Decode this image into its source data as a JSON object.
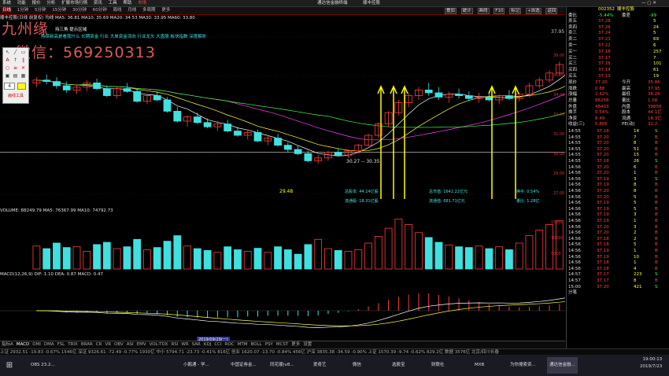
{
  "menu": {
    "items": [
      "系统",
      "功能",
      "报价",
      "分析",
      "扩展市场行情",
      "资讯",
      "工具",
      "帮助",
      "市场"
    ],
    "title": "通达信金融终端",
    "title2": "顺丰控股"
  },
  "tabs": {
    "items": [
      "日线",
      "1分钟",
      "5分钟",
      "15分钟",
      "30分钟",
      "60分钟",
      "周线",
      "月线",
      "多周期",
      "更多"
    ],
    "active": 0
  },
  "toolbar_right": {
    "btns": [
      "叠加",
      "统计",
      "画线",
      "F10",
      "标记",
      "+自选",
      "返回"
    ]
  },
  "watermark": {
    "line1": "九州缘",
    "line2": "微信：569250313"
  },
  "info_line": {
    "text": "顺丰控股(日线 前复权) 均线 MA5: 36.81  MA10: 35.69  MA20: 34.53  MA30: 33.95  MA60: 33.80"
  },
  "subheader": {
    "text": "持续新高是看我什么 长期资金 行业 大单资金流向 行业龙头 大盘股 板块指数 深度解析"
  },
  "annotation": {
    "text": "持三角 提示区域"
  },
  "price_labels": {
    "high": "37.95",
    "low": "29.48",
    "mid": "30.27 -- 30.35"
  },
  "axis_labels": [
    "39.00",
    "36.00",
    "34.00",
    "32.00",
    "31.00",
    "30.00",
    "29.00",
    "27.00",
    "27.52"
  ],
  "info_box": {
    "a": "总股本: 44.14亿股",
    "b": "总市值: 1642.22亿元",
    "c": "换手: 0.54%",
    "d": "流通股: 18.31亿股",
    "e": "流通值: 681.71亿元",
    "f": "量比: 1.28亿"
  },
  "vol_header": {
    "text": "VOLUME: 88249.79  MA5: 76367.99  MA10: 74792.73"
  },
  "vol_axis": [
    "15000",
    "10000",
    "5000"
  ],
  "macd_header": {
    "text": "MACD(12,26,9)  DIF: 1.10  DEA: 0.87  MACD: 0.47"
  },
  "date_label": {
    "text": "2019/09/29(一)"
  },
  "bottom_tabs": {
    "items": [
      "指标A",
      "MACD",
      "DMI",
      "DMA",
      "FSL",
      "TRIX",
      "BRAR",
      "CR",
      "VR",
      "OBV",
      "ASI",
      "EMV",
      "VOL-TDX",
      "RSI",
      "WR",
      "SAR",
      "KDJ",
      "CCI",
      "ROC",
      "MTM",
      "BOLL",
      "PSY",
      "MCST",
      "更多",
      "设置"
    ]
  },
  "status_bar": {
    "text": "上证 2932.51 -19.83 -0.67% 1546亿   深证 9326.61 -72.49 -0.77% 1930亿   中小 5794.71 -23.73 -0.41% 816亿   创业 1620.07 -13.70 -0.84% 456亿   沪深 3835.38 -34.59 -0.90%   上证 1570.39 -9.74 -0.62% 829.2亿   数据 3576亿   北京/四川长春"
  },
  "taskbar": {
    "items": [
      "OBS 23.2...",
      "",
      "小鹅通 - 学...",
      "中国证券金...",
      "同花顺(v8...",
      "爱奇艺",
      "微信",
      "选股宝",
      "财联社",
      "MXB",
      "为你搜索资...",
      "通达信金融..."
    ],
    "clock": "19:00:13",
    "date": "2019/7/23"
  },
  "quote": {
    "code": "002352",
    "name": "顺丰控股",
    "weibi_label": "委比",
    "weibi": "-5.44%",
    "weicha_label": "委差",
    "weicha": "-99",
    "asks": [
      {
        "l": "卖五",
        "p": "37.28",
        "v": "5"
      },
      {
        "l": "卖四",
        "p": "37.26",
        "v": "24"
      },
      {
        "l": "卖三",
        "p": "37.24",
        "v": "5"
      },
      {
        "l": "卖二",
        "p": "37.23",
        "v": "69"
      },
      {
        "l": "卖一",
        "p": "37.22",
        "v": "6"
      }
    ],
    "bids": [
      {
        "l": "买一",
        "p": "37.18",
        "v": "257"
      },
      {
        "l": "买二",
        "p": "37.17",
        "v": "7"
      },
      {
        "l": "买三",
        "p": "37.16",
        "v": "101"
      },
      {
        "l": "买四",
        "p": "37.14",
        "v": "61"
      },
      {
        "l": "买五",
        "p": "37.13",
        "v": "19"
      }
    ],
    "stats": [
      {
        "a": "现价",
        "b": "37.20",
        "c": "今开",
        "d": "35.86"
      },
      {
        "a": "涨跌",
        "b": "0.88",
        "c": "最高",
        "d": "37.95"
      },
      {
        "a": "涨幅",
        "b": "2.42%",
        "c": "最低",
        "d": "36.26"
      },
      {
        "a": "总量",
        "b": "88258",
        "c": "量比",
        "d": "1.08"
      },
      {
        "a": "外盘",
        "b": "48403",
        "c": "内盘",
        "d": "39856"
      },
      {
        "a": "换手",
        "b": "0.54%",
        "c": "股本",
        "d": "44.1亿"
      },
      {
        "a": "净资",
        "b": "8.49",
        "c": "流通",
        "d": "18.3亿"
      },
      {
        "a": "收益(三)",
        "b": "0.866",
        "c": "PE(动)",
        "d": "32.2"
      }
    ],
    "ticks": [
      {
        "t": "14:55",
        "p": "37.18",
        "v": "14",
        "d": "S"
      },
      {
        "t": "14:55",
        "p": "37.20",
        "v": "7",
        "d": "B"
      },
      {
        "t": "14:55",
        "p": "37.20",
        "v": "8",
        "d": "B"
      },
      {
        "t": "14:55",
        "p": "37.20",
        "v": "51",
        "d": "B"
      },
      {
        "t": "14:55",
        "p": "37.20",
        "v": "15",
        "d": "B"
      },
      {
        "t": "14:55",
        "p": "37.18",
        "v": "26",
        "d": "S"
      },
      {
        "t": "14:56",
        "p": "37.20",
        "v": "6",
        "d": "B"
      },
      {
        "t": "14:56",
        "p": "37.20",
        "v": "1",
        "d": "B"
      },
      {
        "t": "14:56",
        "p": "37.19",
        "v": "3",
        "d": "S"
      },
      {
        "t": "14:56",
        "p": "37.19",
        "v": "8",
        "d": "B"
      },
      {
        "t": "14:56",
        "p": "37.20",
        "v": "8",
        "d": "B"
      },
      {
        "t": "14:56",
        "p": "37.20",
        "v": "5",
        "d": "B"
      },
      {
        "t": "14:56",
        "p": "37.19",
        "v": "5",
        "d": "B"
      },
      {
        "t": "14:56",
        "p": "37.19",
        "v": "5",
        "d": "B"
      },
      {
        "t": "14:56",
        "p": "37.19",
        "v": "3",
        "d": "B"
      },
      {
        "t": "14:56",
        "p": "37.19",
        "v": "1",
        "d": "B"
      },
      {
        "t": "14:56",
        "p": "37.20",
        "v": "3",
        "d": "B"
      },
      {
        "t": "14:56",
        "p": "37.20",
        "v": "2",
        "d": "B"
      },
      {
        "t": "14:56",
        "p": "37.18",
        "v": "2",
        "d": "B"
      },
      {
        "t": "14:56",
        "p": "37.18",
        "v": "5",
        "d": "B"
      },
      {
        "t": "14:56",
        "p": "37.19",
        "v": "1",
        "d": "B"
      },
      {
        "t": "14:56",
        "p": "37.19",
        "v": "10",
        "d": "B"
      },
      {
        "t": "14:56",
        "p": "37.18",
        "v": "1",
        "d": "B"
      },
      {
        "t": "14:56",
        "p": "37.18",
        "v": "4",
        "d": "B"
      },
      {
        "t": "14:57",
        "p": "37.17",
        "v": "223",
        "d": "S"
      },
      {
        "t": "14:57",
        "p": "37.17",
        "v": "8",
        "d": "B"
      },
      {
        "t": "15:00",
        "p": "37.20",
        "v": "421",
        "d": "S"
      }
    ],
    "footer": "分笔"
  },
  "chart_data": {
    "type": "candlestick",
    "candles": [
      [
        35.2,
        35.6,
        34.9,
        35.4
      ],
      [
        35.4,
        35.8,
        35.1,
        35.3
      ],
      [
        35.3,
        35.6,
        34.8,
        35.0
      ],
      [
        35.0,
        35.3,
        34.5,
        34.7
      ],
      [
        34.7,
        35.1,
        34.4,
        34.9
      ],
      [
        34.9,
        35.4,
        34.6,
        35.2
      ],
      [
        35.2,
        35.5,
        34.7,
        34.8
      ],
      [
        34.8,
        35.0,
        34.2,
        34.3
      ],
      [
        34.3,
        34.9,
        34.1,
        34.8
      ],
      [
        34.8,
        35.2,
        34.5,
        34.6
      ],
      [
        34.6,
        34.8,
        33.8,
        33.9
      ],
      [
        33.9,
        34.4,
        33.7,
        34.3
      ],
      [
        34.3,
        34.6,
        33.9,
        34.0
      ],
      [
        34.0,
        34.2,
        33.1,
        33.2
      ],
      [
        33.2,
        33.5,
        32.4,
        32.5
      ],
      [
        32.5,
        32.9,
        32.1,
        32.8
      ],
      [
        32.8,
        33.1,
        32.3,
        32.4
      ],
      [
        32.4,
        32.7,
        32.0,
        32.1
      ],
      [
        32.1,
        32.5,
        31.8,
        32.3
      ],
      [
        32.3,
        32.6,
        31.7,
        31.8
      ],
      [
        31.8,
        32.1,
        31.4,
        31.5
      ],
      [
        31.5,
        31.9,
        31.2,
        31.7
      ],
      [
        31.7,
        31.9,
        31.0,
        31.1
      ],
      [
        31.1,
        31.5,
        30.8,
        31.3
      ],
      [
        31.3,
        31.6,
        30.7,
        30.8
      ],
      [
        30.8,
        31.0,
        30.3,
        30.5
      ],
      [
        30.5,
        30.8,
        30.1,
        30.2
      ],
      [
        30.2,
        30.4,
        29.6,
        29.7
      ],
      [
        29.7,
        30.1,
        29.48,
        29.9
      ],
      [
        29.9,
        30.4,
        29.7,
        30.3
      ],
      [
        30.3,
        30.6,
        30.0,
        30.1
      ],
      [
        30.1,
        30.5,
        29.9,
        30.4
      ],
      [
        30.4,
        30.9,
        30.2,
        30.8
      ],
      [
        30.8,
        31.6,
        30.7,
        31.5
      ],
      [
        31.5,
        32.4,
        31.3,
        32.3
      ],
      [
        32.3,
        33.2,
        32.1,
        33.1
      ],
      [
        33.1,
        34.0,
        32.9,
        33.8
      ],
      [
        33.8,
        34.5,
        33.5,
        34.3
      ],
      [
        34.3,
        34.9,
        34.0,
        34.7
      ],
      [
        34.7,
        35.2,
        34.3,
        34.5
      ],
      [
        34.5,
        34.9,
        34.0,
        34.2
      ],
      [
        34.2,
        34.6,
        33.8,
        34.4
      ],
      [
        34.4,
        34.8,
        34.1,
        34.3
      ],
      [
        34.3,
        34.6,
        33.9,
        34.1
      ],
      [
        34.1,
        34.5,
        33.8,
        34.2
      ],
      [
        34.2,
        34.6,
        33.9,
        34.0
      ],
      [
        34.0,
        34.4,
        33.7,
        34.3
      ],
      [
        34.3,
        34.7,
        34.0,
        34.1
      ],
      [
        34.1,
        34.5,
        33.9,
        34.4
      ],
      [
        34.4,
        35.2,
        34.2,
        35.0
      ],
      [
        35.0,
        35.6,
        34.8,
        35.4
      ],
      [
        35.4,
        36.1,
        35.2,
        35.9
      ],
      [
        35.9,
        36.7,
        35.7,
        36.5
      ],
      [
        36.5,
        37.95,
        36.26,
        37.2
      ]
    ],
    "volumes": [
      62,
      55,
      70,
      58,
      60,
      48,
      66,
      72,
      55,
      60,
      80,
      52,
      58,
      75,
      90,
      62,
      55,
      50,
      45,
      60,
      52,
      48,
      56,
      45,
      60,
      52,
      40,
      66,
      80,
      55,
      50,
      48,
      52,
      70,
      88,
      110,
      135,
      120,
      98,
      85,
      72,
      65,
      60,
      58,
      62,
      55,
      60,
      52,
      70,
      90,
      105,
      120,
      130,
      88
    ],
    "ma": {
      "MA5": [],
      "MA10": [],
      "MA20": []
    },
    "ylim": [
      27.0,
      39.0
    ]
  }
}
